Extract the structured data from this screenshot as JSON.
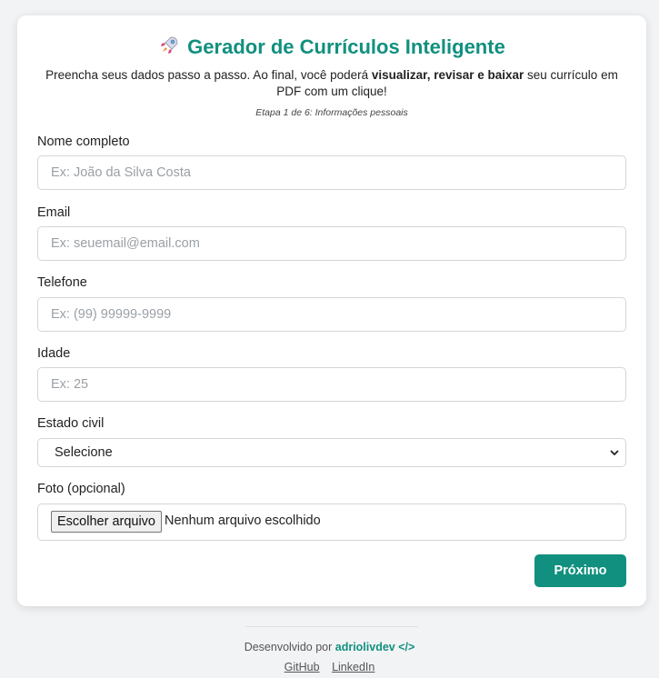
{
  "header": {
    "title": "Gerador de Currículos Inteligente",
    "title_icon": "rocket-icon",
    "subtitle_part1": "Preencha seus dados passo a passo. Ao final, você poderá ",
    "subtitle_bold": "visualizar, revisar e baixar",
    "subtitle_part2": " seu currículo em PDF com um clique!",
    "step_text": "Etapa 1 de 6: Informações pessoais"
  },
  "form": {
    "name": {
      "label": "Nome completo",
      "placeholder": "Ex: João da Silva Costa",
      "value": ""
    },
    "email": {
      "label": "Email",
      "placeholder": "Ex: seuemail@email.com",
      "value": ""
    },
    "phone": {
      "label": "Telefone",
      "placeholder": "Ex: (99) 99999-9999",
      "value": ""
    },
    "age": {
      "label": "Idade",
      "placeholder": "Ex: 25",
      "value": ""
    },
    "marital_status": {
      "label": "Estado civil",
      "selected": "Selecione"
    },
    "photo": {
      "label": "Foto (opcional)",
      "button_label": "Escolher arquivo",
      "status": "Nenhum arquivo escolhido"
    },
    "next_label": "Próximo"
  },
  "footer": {
    "credit_prefix": "Desenvolvido por ",
    "author": "adriolivdev </>",
    "links": [
      "GitHub",
      "LinkedIn"
    ]
  },
  "colors": {
    "accent": "#11907f",
    "background": "#f2f3f5",
    "card": "#ffffff"
  }
}
